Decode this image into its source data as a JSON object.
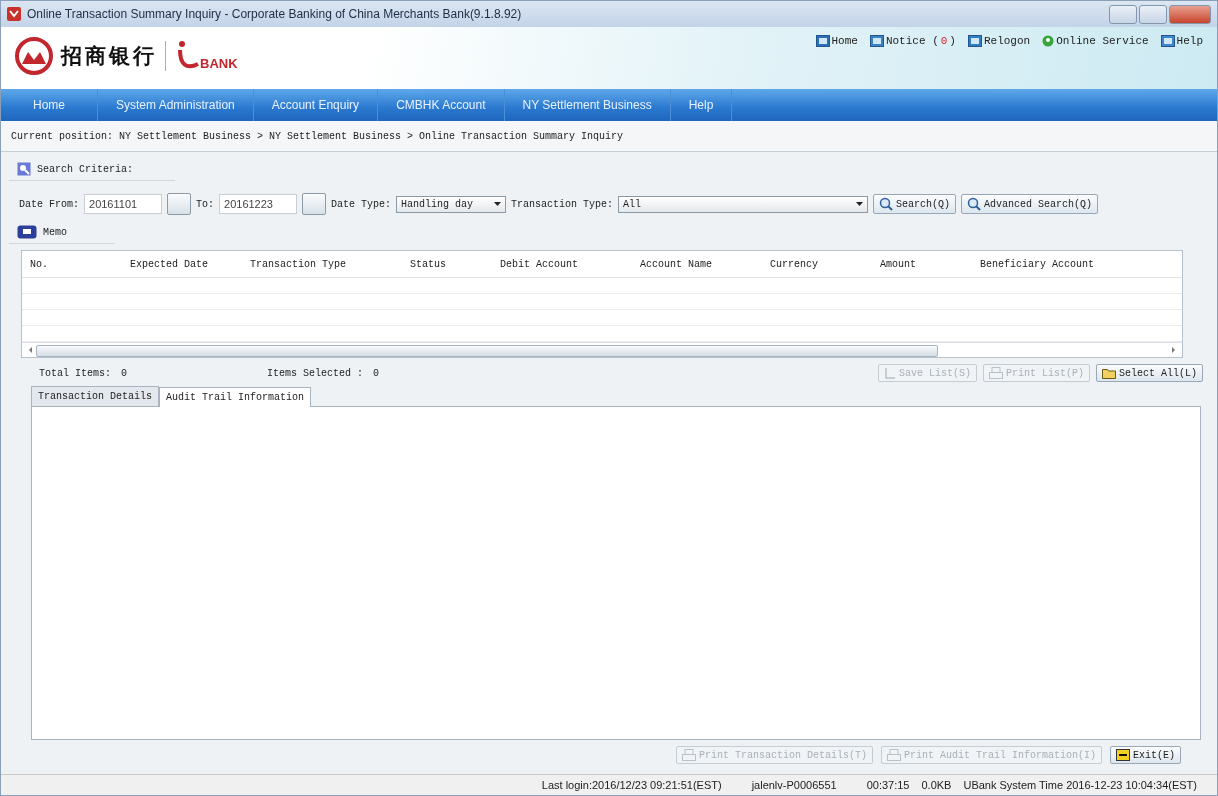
{
  "window": {
    "title": "Online Transaction Summary Inquiry - Corporate Banking of China Merchants Bank(9.1.8.92)"
  },
  "header": {
    "bank_name": "招商银行",
    "product": "BANK",
    "links": [
      {
        "kind": "home",
        "label": "Home"
      },
      {
        "kind": "notice",
        "label": "Notice (",
        "count": "0",
        "suffix": ")"
      },
      {
        "kind": "relogon",
        "label": "Relogon"
      },
      {
        "kind": "service",
        "label": "Online Service"
      },
      {
        "kind": "help",
        "label": "Help"
      }
    ]
  },
  "nav": [
    "Home",
    "System Administration",
    "Account Enquiry",
    "CMBHK Account",
    "NY Settlement Business",
    "Help"
  ],
  "breadcrumb": "Current position: NY Settlement Business > NY Settlement Business > Online Transaction Summary Inquiry",
  "search_criteria": {
    "title": "Search Criteria:",
    "date_from_label": "Date From:",
    "date_from": "20161101",
    "to_label": "To:",
    "date_to": "20161223",
    "date_type_label": "Date Type:",
    "date_type": "Handling day",
    "transaction_type_label": "Transaction Type:",
    "transaction_type": "All",
    "search_button": "Search(Q)",
    "advanced_button": "Advanced Search(Q)"
  },
  "memo": "Memo",
  "table": {
    "columns": [
      "No.",
      "Expected Date",
      "Transaction Type",
      "Status",
      "Debit Account",
      "Account Name",
      "Currency",
      "Amount",
      "Beneficiary Account"
    ]
  },
  "totals": {
    "total_label": "Total Items:",
    "total": "0",
    "selected_label": "Items Selected :",
    "selected": "0"
  },
  "list_buttons": [
    {
      "kind": "save",
      "label": "Save List(S)",
      "disabled": true
    },
    {
      "kind": "print",
      "label": "Print List(P)",
      "disabled": true
    },
    {
      "kind": "select",
      "label": "Select All(L)",
      "disabled": false
    }
  ],
  "tabs": [
    {
      "label": "Transaction Details",
      "selected": false
    },
    {
      "label": "Audit Trail Information",
      "selected": true
    }
  ],
  "bottom_buttons": [
    {
      "kind": "print",
      "label": "Print Transaction Details(T)",
      "disabled": true
    },
    {
      "kind": "print",
      "label": "Print Audit Trail Information(I)",
      "disabled": true
    },
    {
      "kind": "exit",
      "label": "Exit(E)",
      "disabled": false
    }
  ],
  "status_bar": [
    "Last login:2016/12/23 09:21:51(EST)",
    "jalenlv-P0006551",
    "00:37:15",
    "0.0KB",
    "UBank System Time 2016-12-23 10:04:34(EST)"
  ]
}
